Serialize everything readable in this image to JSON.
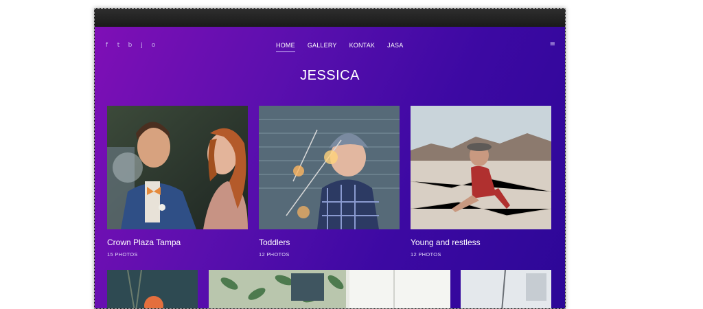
{
  "social": [
    "f",
    "t",
    "b",
    "j",
    "o"
  ],
  "social_icons": [
    "facebook-icon",
    "twitter-icon",
    "behance-icon",
    "vine-icon",
    "instagram-icon"
  ],
  "nav": [
    {
      "label": "HOME",
      "active": true
    },
    {
      "label": "GALLERY",
      "active": false
    },
    {
      "label": "KONTAK",
      "active": false
    },
    {
      "label": "JASA",
      "active": false
    }
  ],
  "menu_icon": "hamburger-menu-icon",
  "site_title": "JESSICA",
  "albums": [
    {
      "name": "Crown Plaza Tampa",
      "count": "15 PHOTOS",
      "photo": "wedding-couple-photo"
    },
    {
      "name": "Toddlers",
      "count": "12 PHOTOS",
      "photo": "child-with-sparkler-photo"
    },
    {
      "name": "Young and restless",
      "count": "12 PHOTOS",
      "photo": "woman-in-desert-photo"
    }
  ],
  "colors": {
    "gradient_start": "#7f0fb6",
    "gradient_end": "#2c0797",
    "text": "#ffffff"
  }
}
